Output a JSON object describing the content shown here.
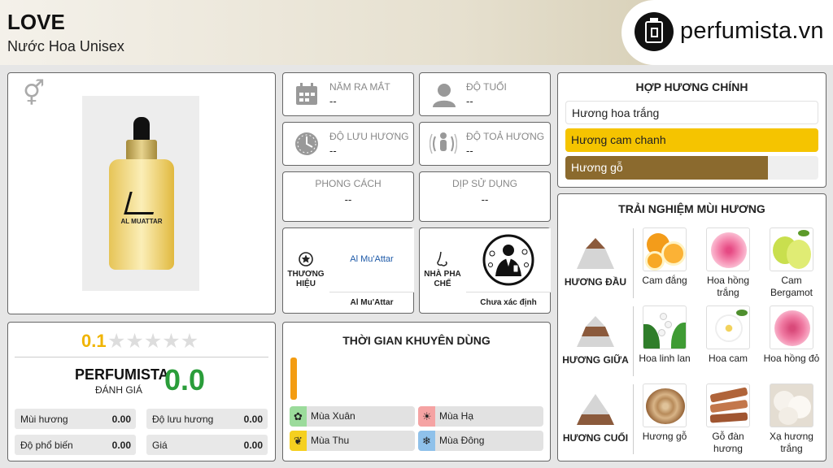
{
  "header": {
    "title": "LOVE",
    "subtitle": "Nước Hoa Unisex",
    "logo_text": "perfumista.vn"
  },
  "product": {
    "gender_icon": "unisex-gender-icon",
    "bottle_brand": "AL MUATTAR"
  },
  "info": {
    "launch": {
      "label": "NĂM RA MẮT",
      "value": "--"
    },
    "age": {
      "label": "ĐỘ TUỔI",
      "value": "--"
    },
    "longevity": {
      "label": "ĐỘ LƯU HƯƠNG",
      "value": "--"
    },
    "sillage": {
      "label": "ĐỘ TOẢ HƯƠNG",
      "value": "--"
    },
    "style": {
      "label": "PHONG CÁCH",
      "value": "--"
    },
    "occasion": {
      "label": "DỊP SỬ DỤNG",
      "value": "--"
    },
    "brand": {
      "label": "THƯƠNG HIỆU",
      "logo_text": "Al Mu'Attar",
      "name": "Al Mu'Attar"
    },
    "perfumer": {
      "label": "NHÀ PHA CHẾ",
      "name": "Chưa xác định"
    }
  },
  "accords": {
    "title": "HỢP HƯƠNG CHÍNH",
    "items": [
      {
        "label": "Hương hoa trắng",
        "level": 0,
        "color": "#ffffff",
        "text_color": "#222222"
      },
      {
        "label": "Hương cam chanh",
        "level": 100,
        "color": "#f5c400",
        "text_color": "#222222"
      },
      {
        "label": "Hương gỗ",
        "level": 80,
        "color": "#8b6a2e",
        "text_color": "#ffffff"
      }
    ]
  },
  "notes": {
    "title": "TRẢI NGHIỆM MÙI HƯƠNG",
    "top": {
      "label": "HƯƠNG ĐẦU",
      "items": [
        "Cam đắng",
        "Hoa hồng trắng",
        "Cam Bergamot"
      ]
    },
    "middle": {
      "label": "HƯƠNG GIỮA",
      "items": [
        "Hoa linh lan",
        "Hoa cam",
        "Hoa hồng đỏ"
      ]
    },
    "base": {
      "label": "HƯƠNG CUỐI",
      "items": [
        "Hương gỗ",
        "Gỗ đàn hương",
        "Xạ hương trắng"
      ]
    }
  },
  "rating": {
    "user_score": "0.1",
    "stars_filled": 0,
    "brand": "PERFUMISTA",
    "brand_sub": "ĐÁNH GIÁ",
    "score": "0.0",
    "stats": [
      {
        "label": "Mùi hương",
        "value": "0.00"
      },
      {
        "label": "Độ lưu hương",
        "value": "0.00"
      },
      {
        "label": "Độ phổ biến",
        "value": "0.00"
      },
      {
        "label": "Giá",
        "value": "0.00"
      }
    ]
  },
  "seasons": {
    "title": "THỜI GIAN KHUYÊN DÙNG",
    "bar_color": "#f39c12",
    "items": [
      {
        "label": "Mùa Xuân",
        "icon": "flower-icon",
        "color": "#9bdb9b"
      },
      {
        "label": "Mùa Hạ",
        "icon": "sun-icon",
        "color": "#f5a3a3"
      },
      {
        "label": "Mùa Thu",
        "icon": "leaf-icon",
        "color": "#f5d020"
      },
      {
        "label": "Mùa Đông",
        "icon": "snowflake-icon",
        "color": "#8fc1ea"
      }
    ]
  }
}
